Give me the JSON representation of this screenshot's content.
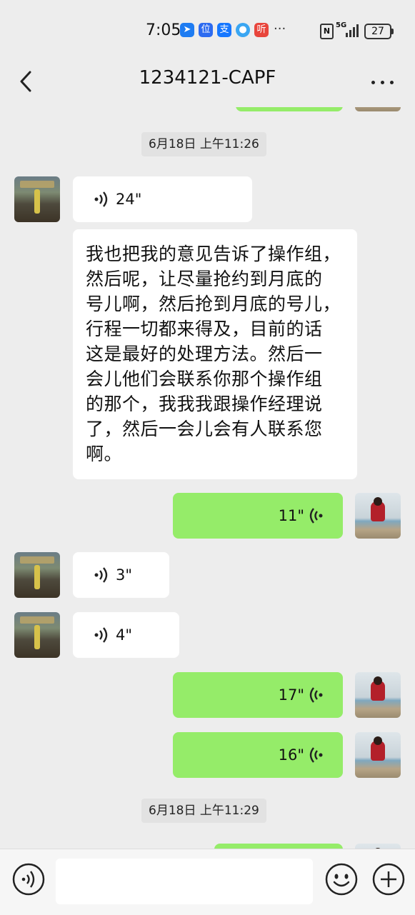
{
  "status_bar": {
    "time": "7:05",
    "apps": [
      "位",
      "支",
      "听"
    ],
    "more": "···",
    "nfc": "N",
    "network": "5G",
    "battery": "27"
  },
  "header": {
    "title": "1234121-CAPF"
  },
  "messages": [
    {
      "type": "timestamp",
      "text": "6月18日 上午11:26"
    },
    {
      "type": "voice",
      "from": "other",
      "duration": "24\""
    },
    {
      "type": "text",
      "from": "other",
      "lines": [
        "我也把我的意见告诉了操作组，",
        "然后呢，让尽量抢约到月底的",
        "号儿啊，然后抢到月底的号儿，",
        "行程一切都来得及，目前的话",
        "这是最好的处理方法。然后一",
        "会儿他们会联系你那个操作组",
        "的那个，我我我跟操作经理说",
        "了，然后一会儿会有人联系您",
        "啊。"
      ]
    },
    {
      "type": "voice",
      "from": "self",
      "duration": "11\""
    },
    {
      "type": "voice",
      "from": "other",
      "duration": "3\""
    },
    {
      "type": "voice",
      "from": "other",
      "duration": "4\""
    },
    {
      "type": "voice",
      "from": "self",
      "duration": "17\""
    },
    {
      "type": "voice",
      "from": "self",
      "duration": "16\""
    },
    {
      "type": "timestamp",
      "text": "6月18日 上午11:29"
    }
  ],
  "input_bar": {
    "voice_icon": "voice-mode-icon",
    "emoji_icon": "emoji-icon",
    "plus_icon": "plus-icon"
  }
}
